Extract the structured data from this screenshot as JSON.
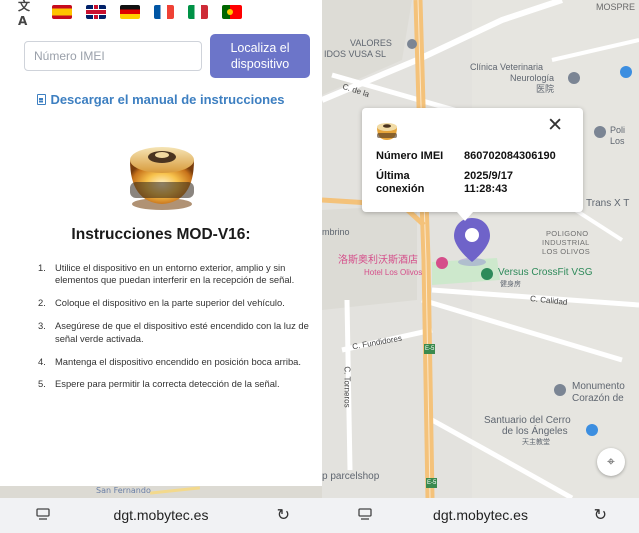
{
  "left": {
    "language_flags": [
      "es",
      "gb",
      "de",
      "fr",
      "it",
      "pt"
    ],
    "translate_icon": "translate-icon",
    "imei_placeholder": "Número IMEI",
    "locate_button": "Localiza el dispositivo",
    "manual_link": "Descargar el manual de instrucciones",
    "instructions_title": "Instrucciones MOD-V16:",
    "instructions": [
      {
        "num": "1.",
        "text": "Utilice el dispositivo en un entorno exterior, amplio y sin elementos que puedan interferir en la recepción de señal."
      },
      {
        "num": "2.",
        "text": "Coloque el dispositivo en la parte superior del vehículo."
      },
      {
        "num": "3.",
        "text": "Asegúrese de que el dispositivo esté encendido con la luz de señal verde activada."
      },
      {
        "num": "4.",
        "text": "Mantenga el dispositivo encendido en posición boca arriba."
      },
      {
        "num": "5.",
        "text": "Espere para permitir la correcta detección de la señal."
      }
    ],
    "bottom_map_label": "San Fernando"
  },
  "map": {
    "labels": {
      "valores": "VALORES",
      "vusa": "IDOS VUSA SL",
      "clinica1": "Clínica Veterinaria",
      "clinica2": "Neurología",
      "clinica3": "医院",
      "poli1": "Poli",
      "poli2": "Los",
      "trans": "Trans X T",
      "mbrino": "mbrino",
      "poligono1": "POLIGONO",
      "poligono2": "INDUSTRIAL",
      "poligono3": "LOS OLIVOS",
      "hotel_cn": "洛斯奥利沃斯酒店",
      "hotel": "Hotel Los Olivos",
      "versus": "Versus CrossFit VSG",
      "versus_cn": "健身房",
      "calidad": "C. Calidad",
      "fundidores": "C. Fundidores",
      "torneros": "C. Torneros",
      "de_la": "C. de la",
      "e5a": "E-5",
      "e5b": "E-5",
      "monumento1": "Monumento",
      "monumento2": "Corazón de",
      "santuario1": "Santuario del Cerro",
      "santuario2": "de los Ángeles",
      "santuario3": "天主教堂",
      "parcelshop": "p parcelshop",
      "mosp": "MOSPRE"
    },
    "popup": {
      "imei_label": "Número IMEI",
      "imei_value": "860702084306190",
      "last_label_1": "Última",
      "last_label_2": "conexión",
      "last_date": "2025/9/17",
      "last_time": "11:28:43",
      "close": "✕"
    },
    "recenter_icon": "⌖"
  },
  "browser": {
    "url_left": "dgt.mobytec.es",
    "url_right": "dgt.mobytec.es",
    "reload_icon": "↻"
  }
}
